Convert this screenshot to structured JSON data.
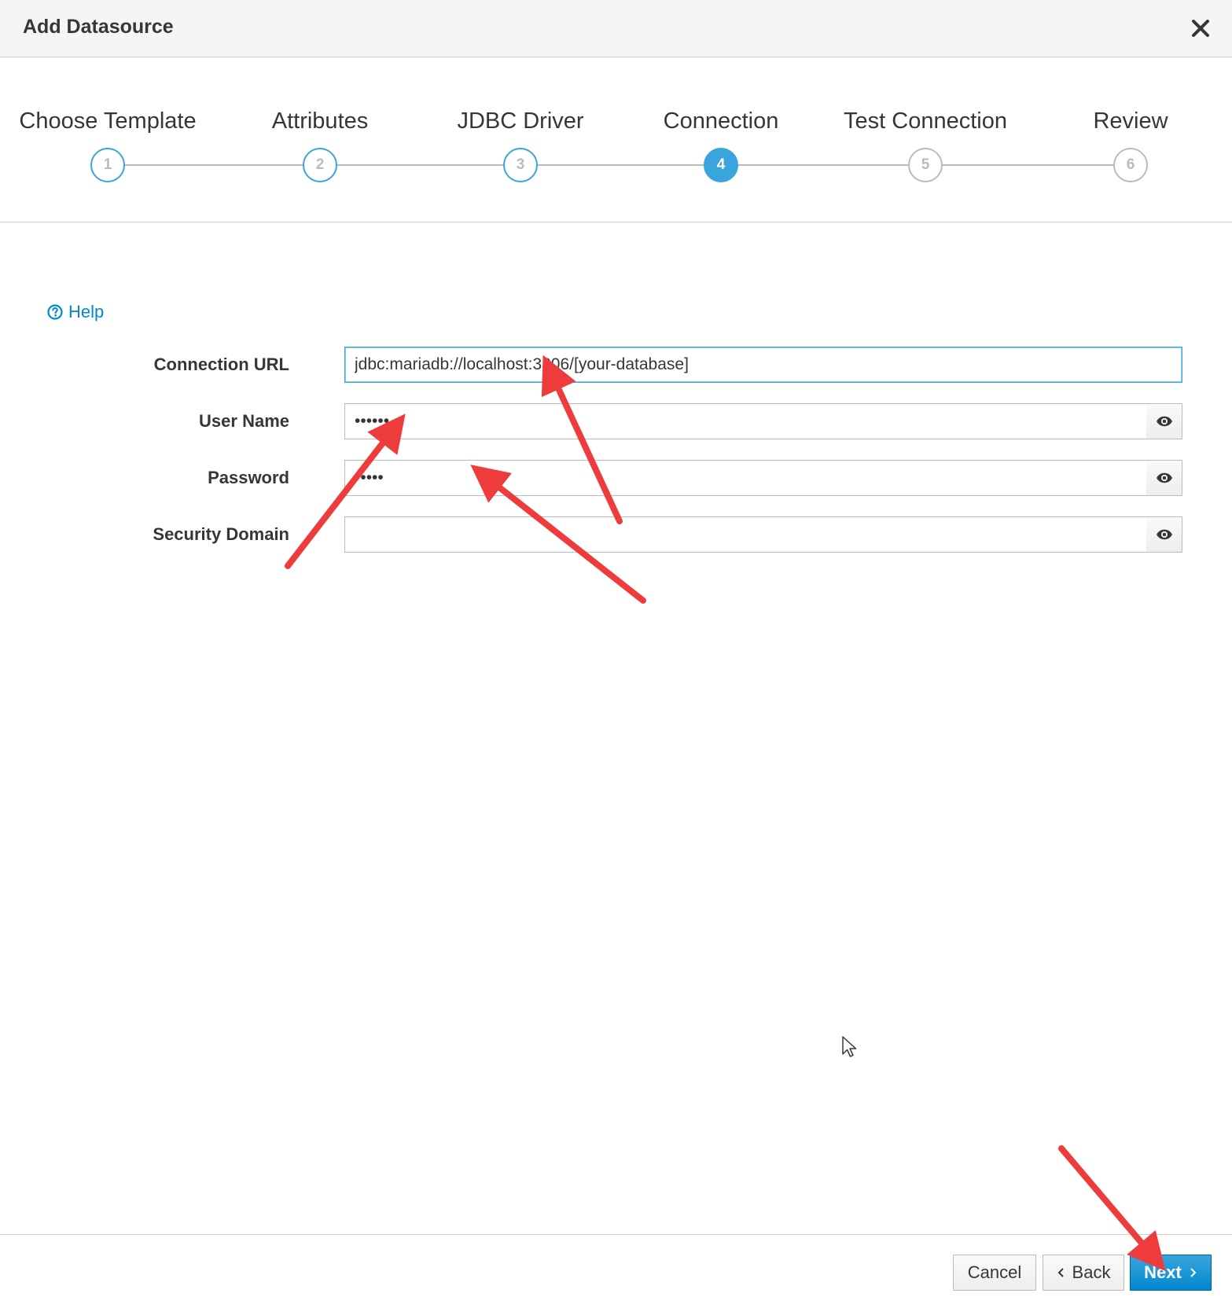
{
  "dialog": {
    "title": "Add Datasource",
    "close_icon": "close-icon"
  },
  "wizard": {
    "steps": [
      {
        "label": "Choose Template",
        "number": "1",
        "state": "completed"
      },
      {
        "label": "Attributes",
        "number": "2",
        "state": "completed"
      },
      {
        "label": "JDBC Driver",
        "number": "3",
        "state": "completed"
      },
      {
        "label": "Connection",
        "number": "4",
        "state": "active"
      },
      {
        "label": "Test Connection",
        "number": "5",
        "state": "future"
      },
      {
        "label": "Review",
        "number": "6",
        "state": "future"
      }
    ]
  },
  "help": {
    "label": "Help",
    "icon": "question-circle-icon"
  },
  "form": {
    "connection_url": {
      "label": "Connection URL",
      "value": "jdbc:mariadb://localhost:3306/[your-database]"
    },
    "user_name": {
      "label": "User Name",
      "value": "••••••",
      "icon": "eye-icon"
    },
    "password": {
      "label": "Password",
      "value": "•••••",
      "icon": "eye-icon"
    },
    "security_domain": {
      "label": "Security Domain",
      "value": "",
      "icon": "eye-icon"
    }
  },
  "footer": {
    "cancel_label": "Cancel",
    "back_label": "Back",
    "next_label": "Next",
    "back_icon": "chevron-left-icon",
    "next_icon": "chevron-right-icon"
  },
  "colors": {
    "accent": "#39a5dc",
    "primary_button": "#0088ce",
    "annotation_arrow": "#ee3b3b",
    "header_bg": "#f5f5f5"
  }
}
